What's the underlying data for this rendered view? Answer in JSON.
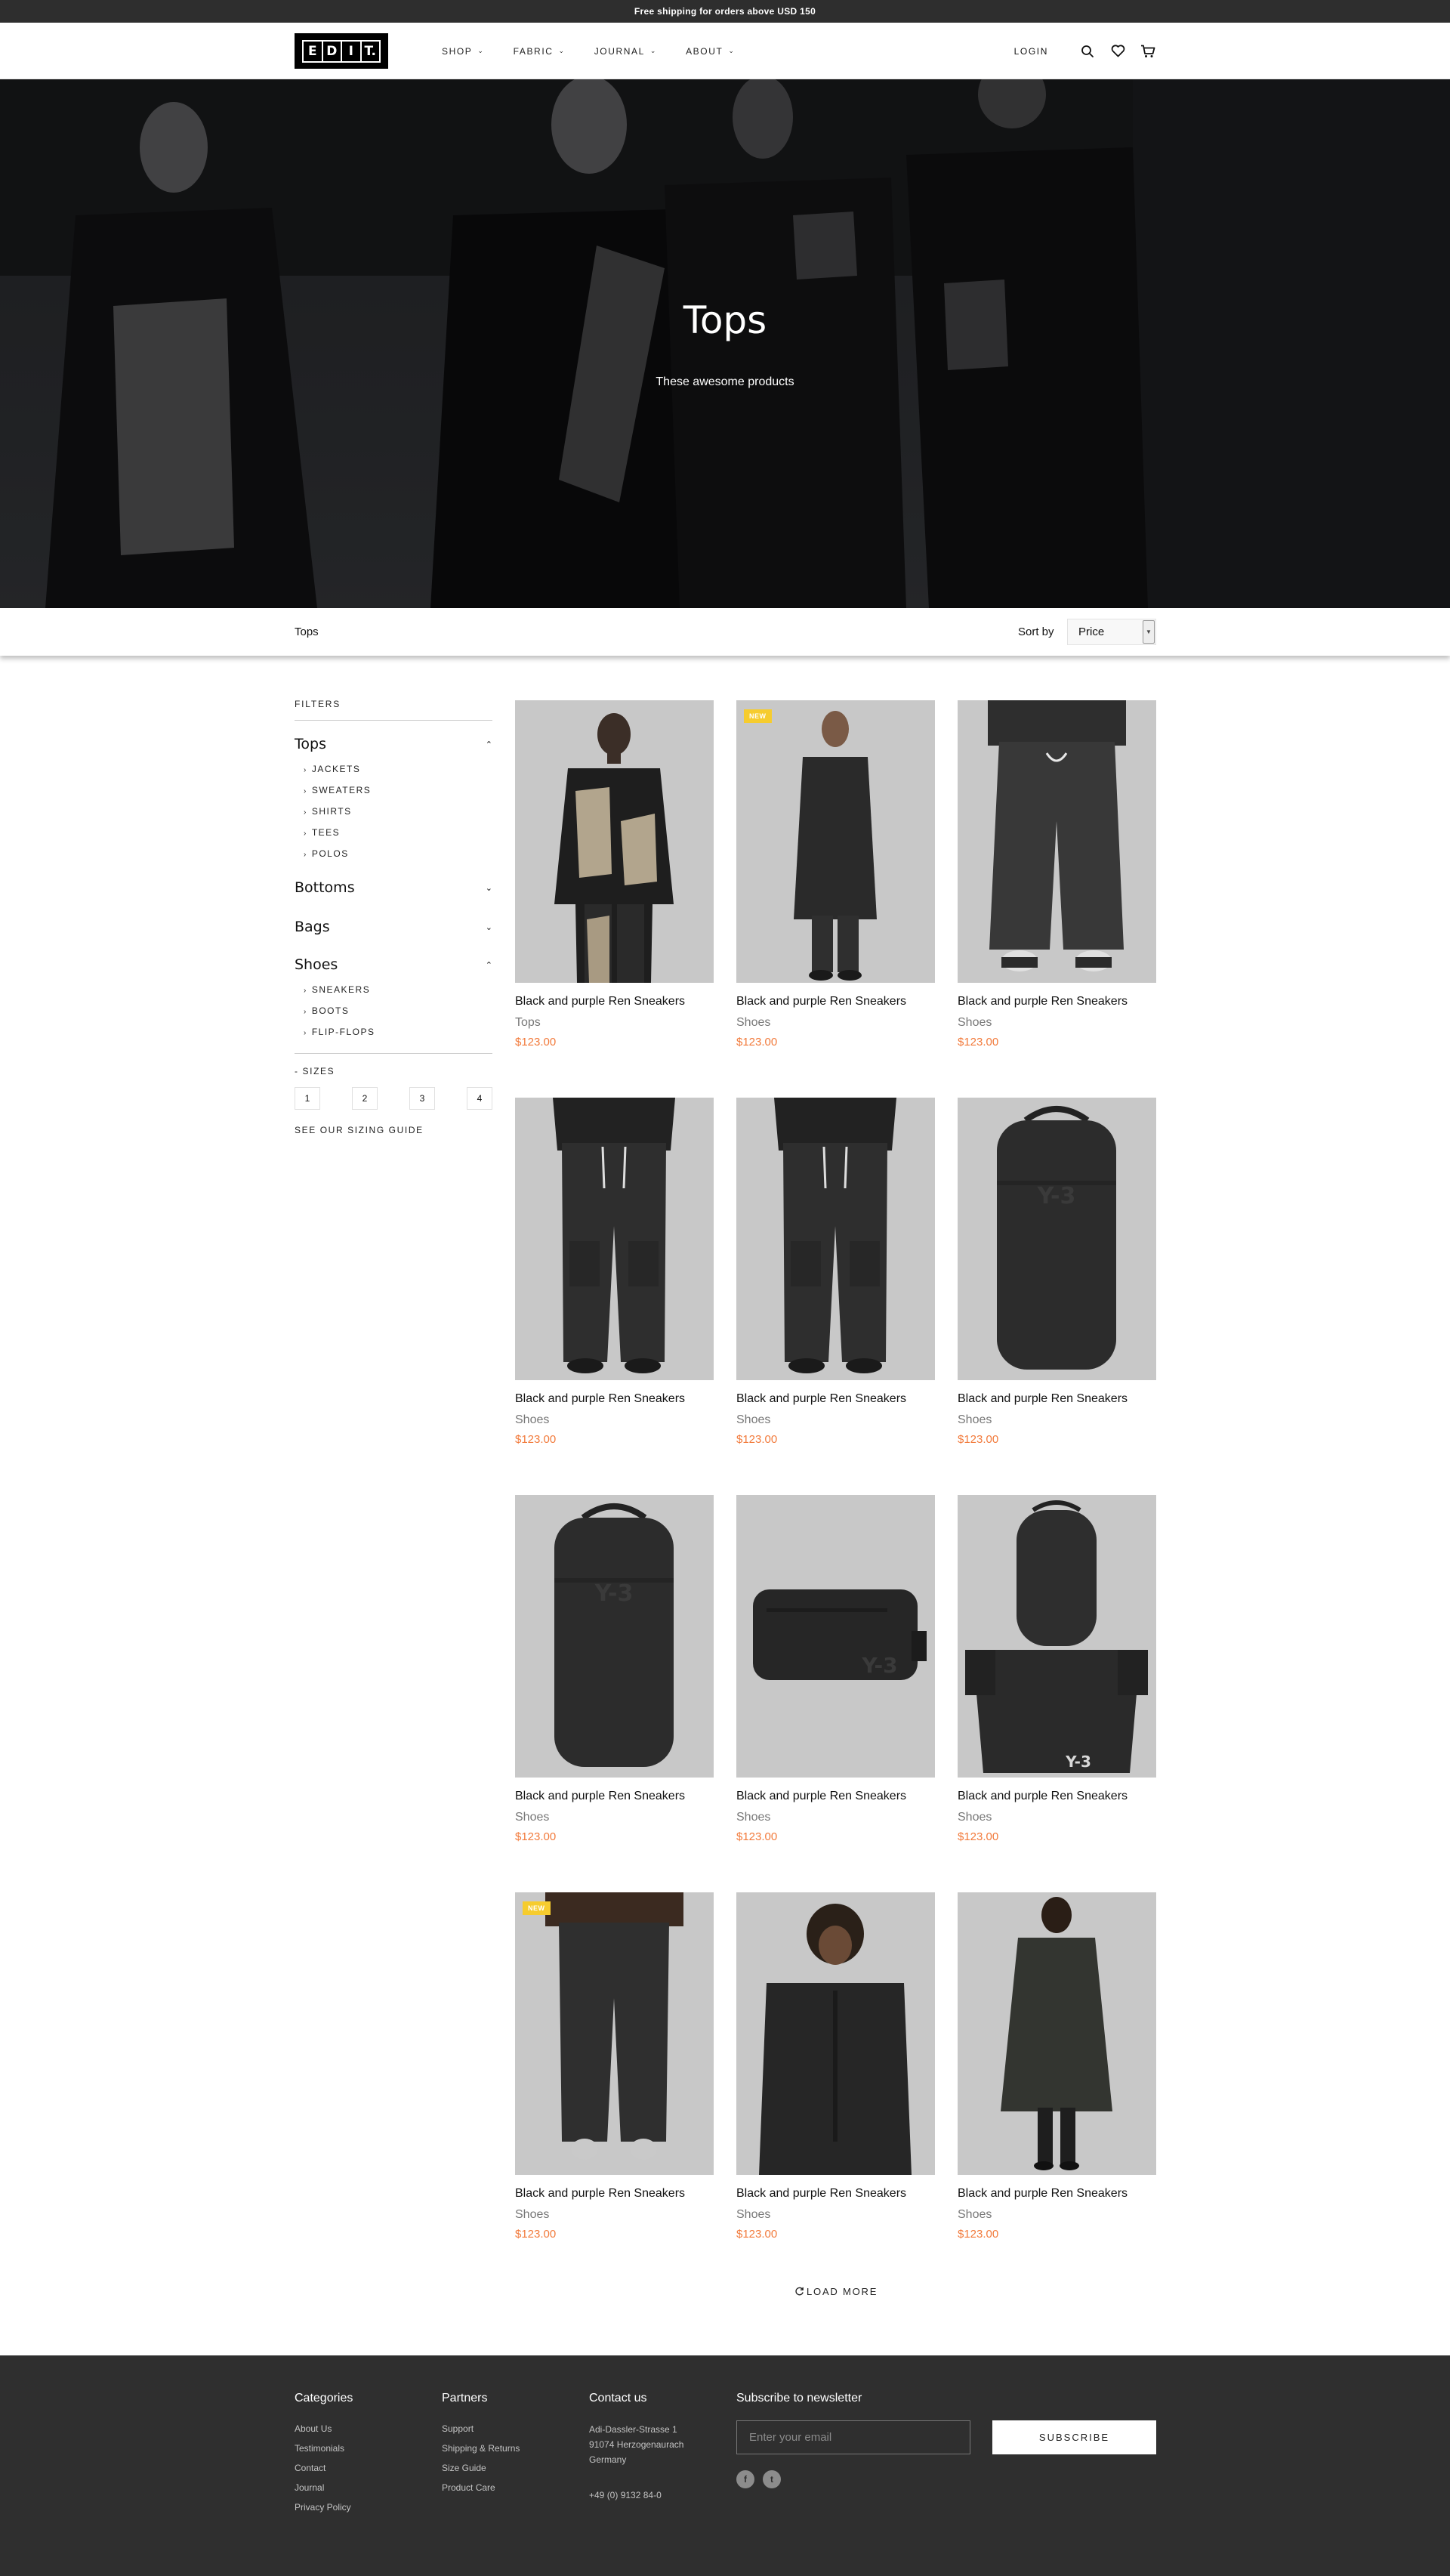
{
  "topbar": {
    "text": "Free shipping for orders above USD 150"
  },
  "header": {
    "logo_letters": [
      "E",
      "D",
      "I",
      "T."
    ],
    "nav": [
      {
        "label": "SHOP"
      },
      {
        "label": "FABRIC"
      },
      {
        "label": "JOURNAL"
      },
      {
        "label": "ABOUT"
      }
    ],
    "login_label": "LOGIN",
    "icons": [
      "search-icon",
      "heart-icon",
      "cart-icon"
    ]
  },
  "hero": {
    "title": "Tops",
    "subtitle": "These awesome products"
  },
  "toolbar": {
    "breadcrumb": "Tops",
    "sort_label": "Sort by",
    "sort_value": "Price"
  },
  "sidebar": {
    "filters_title": "FILTERS",
    "categories": [
      {
        "name": "Tops",
        "expanded": true,
        "subs": [
          "JACKETS",
          "SWEATERS",
          "SHIRTS",
          "TEES",
          "POLOS"
        ]
      },
      {
        "name": "Bottoms",
        "expanded": false,
        "subs": []
      },
      {
        "name": "Bags",
        "expanded": false,
        "subs": []
      },
      {
        "name": "Shoes",
        "expanded": true,
        "subs": [
          "SNEAKERS",
          "BOOTS",
          "FLIP-FLOPS"
        ]
      }
    ],
    "sizes_title": "- SIZES",
    "sizes": [
      "1",
      "2",
      "3",
      "4"
    ],
    "sizing_guide": "SEE OUR SIZING GUIDE"
  },
  "products": [
    {
      "name": "Black and purple Ren Sneakers",
      "category": "Tops",
      "price": "$123.00",
      "badge": "",
      "image": "jacket-model"
    },
    {
      "name": "Black and purple Ren Sneakers",
      "category": "Shoes",
      "price": "$123.00",
      "badge": "NEW",
      "image": "long-coat-model"
    },
    {
      "name": "Black and purple Ren Sneakers",
      "category": "Shoes",
      "price": "$123.00",
      "badge": "",
      "image": "wide-pants"
    },
    {
      "name": "Black and purple Ren Sneakers",
      "category": "Shoes",
      "price": "$123.00",
      "badge": "",
      "image": "cargo-pants"
    },
    {
      "name": "Black and purple Ren Sneakers",
      "category": "Shoes",
      "price": "$123.00",
      "badge": "",
      "image": "cargo-pants"
    },
    {
      "name": "Black and purple Ren Sneakers",
      "category": "Shoes",
      "price": "$123.00",
      "badge": "",
      "image": "backpack"
    },
    {
      "name": "Black and purple Ren Sneakers",
      "category": "Shoes",
      "price": "$123.00",
      "badge": "",
      "image": "backpack"
    },
    {
      "name": "Black and purple Ren Sneakers",
      "category": "Shoes",
      "price": "$123.00",
      "badge": "",
      "image": "belt-bag"
    },
    {
      "name": "Black and purple Ren Sneakers",
      "category": "Shoes",
      "price": "$123.00",
      "badge": "",
      "image": "sling-bag"
    },
    {
      "name": "Black and purple Ren Sneakers",
      "category": "Shoes",
      "price": "$123.00",
      "badge": "NEW",
      "image": "track-pants"
    },
    {
      "name": "Black and purple Ren Sneakers",
      "category": "Shoes",
      "price": "$123.00",
      "badge": "",
      "image": "hoodie-model"
    },
    {
      "name": "Black and purple Ren Sneakers",
      "category": "Shoes",
      "price": "$123.00",
      "badge": "",
      "image": "parka-model"
    }
  ],
  "load_more": "LOAD MORE",
  "footer": {
    "categories": {
      "title": "Categories",
      "links": [
        "About Us",
        "Testimonials",
        "Contact",
        "Journal",
        "Privacy Policy"
      ]
    },
    "partners": {
      "title": "Partners",
      "links": [
        "Support",
        "Shipping & Returns",
        "Size Guide",
        "Product Care"
      ]
    },
    "contact": {
      "title": "Contact us",
      "address": [
        "Adi-Dassler-Strasse 1",
        "91074 Herzogenaurach",
        "Germany"
      ],
      "phone": "+49 (0) 9132 84-0"
    },
    "newsletter": {
      "title": "Subscribe to newsletter",
      "placeholder": "Enter your email",
      "button": "SUBSCRIBE"
    },
    "social": [
      {
        "icon": "facebook-icon",
        "glyph": "f"
      },
      {
        "icon": "twitter-icon",
        "glyph": "t"
      }
    ]
  },
  "colors": {
    "topbar_bg": "#2e2e2e",
    "price": "#f27a3b",
    "badge": "#f6cc2e",
    "footer_bg": "#2f2f2f",
    "product_bg": "#c8c8c8"
  }
}
